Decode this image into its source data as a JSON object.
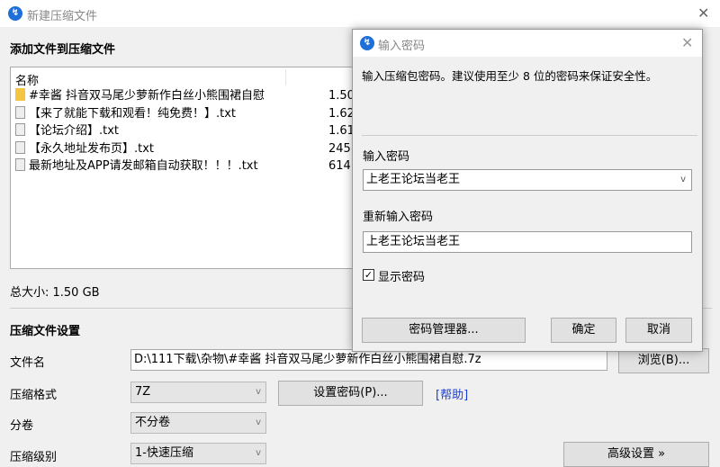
{
  "main": {
    "title": "新建压缩文件",
    "section_add": "添加文件到压缩文件",
    "list": {
      "column_name": "名称",
      "rows": [
        {
          "icon": "folder-icon",
          "name": "#幸酱 抖音双马尾少萝新作白丝小熊围裙自慰",
          "size": "1.50"
        },
        {
          "icon": "file-icon",
          "name": "【来了就能下载和观看！纯免费！】.txt",
          "size": "1.62"
        },
        {
          "icon": "file-icon",
          "name": "【论坛介绍】.txt",
          "size": "1.61"
        },
        {
          "icon": "file-icon",
          "name": "【永久地址发布页】.txt",
          "size": "245"
        },
        {
          "icon": "file-icon",
          "name": "最新地址及APP请发邮箱自动获取！！！.txt",
          "size": "614"
        }
      ]
    },
    "total_size": "总大小: 1.50 GB",
    "section_settings": "压缩文件设置",
    "filename_label": "文件名",
    "filename_value": "D:\\111下载\\杂物\\#幸酱 抖音双马尾少萝新作白丝小熊围裙自慰.7z",
    "browse_button": "浏览(B)...",
    "format_label": "压缩格式",
    "format_value": "7Z",
    "set_password_button": "设置密码(P)...",
    "help_link": "[帮助]",
    "split_label": "分卷",
    "split_value": "不分卷",
    "level_label": "压缩级别",
    "level_value": "1-快速压缩",
    "advanced_button": "高级设置 »"
  },
  "dialog": {
    "title": "输入密码",
    "description": "输入压缩包密码。建议使用至少 8 位的密码来保证安全性。",
    "password_label": "输入密码",
    "password_value": "上老王论坛当老王",
    "reenter_label": "重新输入密码",
    "reenter_value": "上老王论坛当老王",
    "show_password_label": "显示密码",
    "show_password_checked": true,
    "manager_button": "密码管理器...",
    "ok_button": "确定",
    "cancel_button": "取消"
  },
  "colors": {
    "accent": "#1e6fd9",
    "link": "#1a3fd6"
  }
}
